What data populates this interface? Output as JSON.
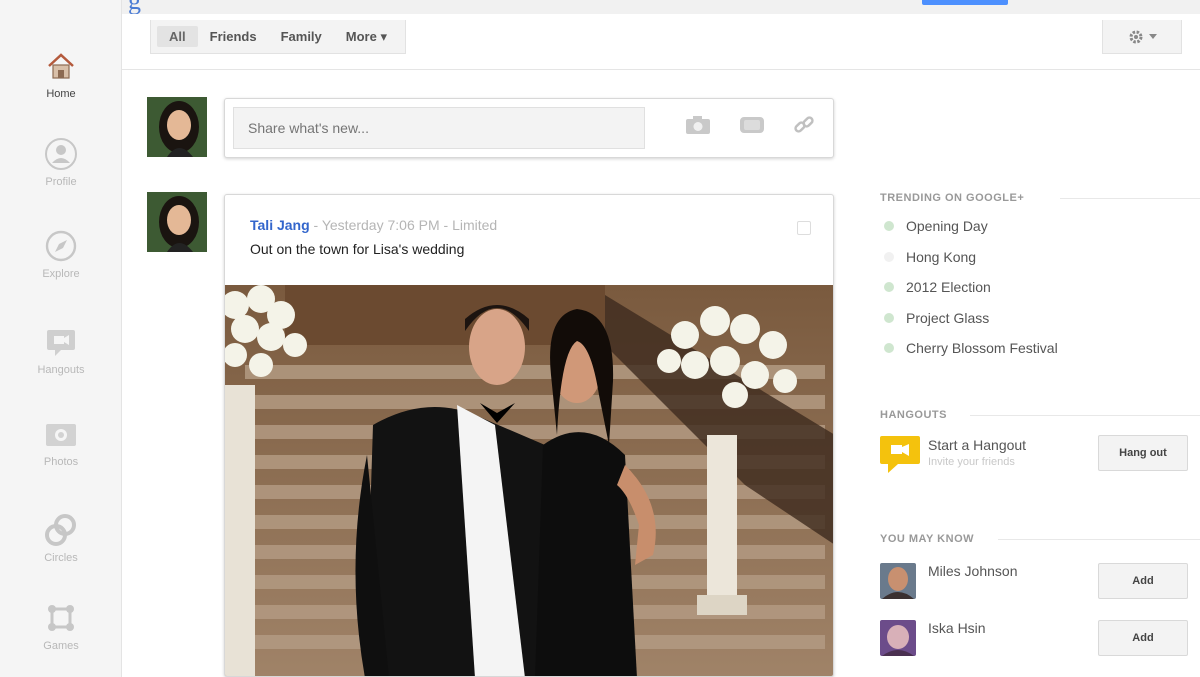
{
  "brand": {
    "logo_fragment": "g"
  },
  "nav": {
    "items": [
      {
        "label": "Home",
        "icon": "home-icon"
      },
      {
        "label": "Profile",
        "icon": "profile-icon"
      },
      {
        "label": "Explore",
        "icon": "explore-icon"
      },
      {
        "label": "Hangouts",
        "icon": "hangouts-icon"
      },
      {
        "label": "Photos",
        "icon": "photos-icon"
      },
      {
        "label": "Circles",
        "icon": "circles-icon"
      },
      {
        "label": "Games",
        "icon": "games-icon"
      }
    ]
  },
  "filters": {
    "tabs": [
      "All",
      "Friends",
      "Family",
      "More ▾"
    ]
  },
  "share": {
    "placeholder": "Share what's new..."
  },
  "post": {
    "author": "Tali Jang",
    "meta": " - Yesterday 7:06 PM - Limited",
    "text": "Out on the town for Lisa's wedding"
  },
  "trending": {
    "title": "TRENDING ON GOOGLE+",
    "items": [
      "Opening Day",
      "Hong Kong",
      "2012 Election",
      "Project Glass",
      "Cherry Blossom Festival"
    ]
  },
  "hangouts": {
    "title": "HANGOUTS",
    "start_label": "Start a Hangout",
    "invite_label": "Invite your friends",
    "button": "Hang out"
  },
  "people": {
    "title": "YOU MAY KNOW",
    "list": [
      {
        "name": "Miles Johnson",
        "button": "Add"
      },
      {
        "name": "Iska Hsin",
        "button": "Add"
      }
    ]
  },
  "colors": {
    "link": "#3366cc",
    "accent": "#4d90fe",
    "hangout_yellow": "#f4c20d"
  }
}
